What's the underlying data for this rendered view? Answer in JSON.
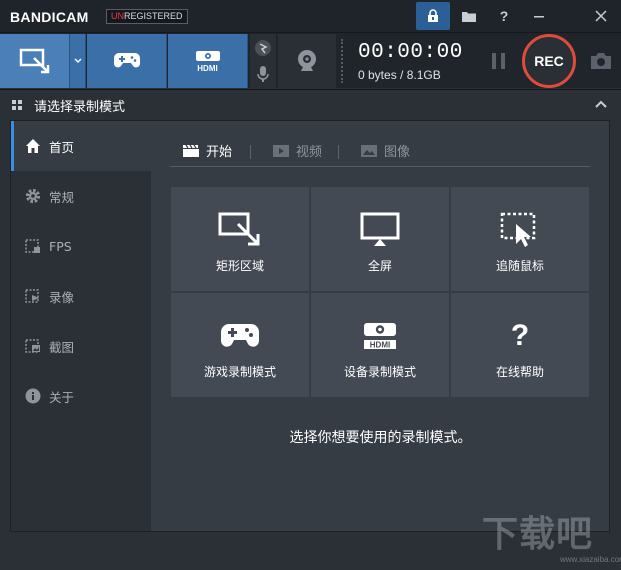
{
  "app": {
    "logo_bandi": "BANDI",
    "logo_cam": "CAM",
    "unreg_prefix": "UN",
    "unreg_rest": "REGISTERED"
  },
  "toolbar": {
    "timer": "00:00:00",
    "size": "0 bytes / 8.1GB",
    "rec_label": "REC",
    "hdmi_label": "HDMI"
  },
  "section": {
    "title": "请选择录制模式"
  },
  "sidebar": {
    "items": [
      {
        "label": "首页",
        "icon": "home-icon",
        "active": true
      },
      {
        "label": "常规",
        "icon": "gear-icon"
      },
      {
        "label": "FPS",
        "icon": "fps-icon"
      },
      {
        "label": "录像",
        "icon": "video-icon"
      },
      {
        "label": "截图",
        "icon": "image-icon"
      },
      {
        "label": "关于",
        "icon": "info-icon"
      }
    ]
  },
  "tabs": [
    {
      "label": "开始",
      "icon": "clapper-icon",
      "active": true
    },
    {
      "label": "视频",
      "icon": "play-icon"
    },
    {
      "label": "图像",
      "icon": "picture-icon"
    }
  ],
  "tiles": [
    {
      "label": "矩形区域",
      "icon": "rectangle-area-icon"
    },
    {
      "label": "全屏",
      "icon": "monitor-icon"
    },
    {
      "label": "追随鼠标",
      "icon": "cursor-follow-icon"
    },
    {
      "label": "游戏录制模式",
      "icon": "gamepad-icon"
    },
    {
      "label": "设备录制模式",
      "icon": "hdmi-icon"
    },
    {
      "label": "在线帮助",
      "icon": "question-icon"
    }
  ],
  "hint": "选择你想要使用的录制模式。",
  "watermark": {
    "text": "下载吧",
    "url": "www.xiazaiba.com"
  },
  "colors": {
    "accent": "#3a6fa8",
    "rec_ring": "#e04c3c",
    "background": "#2b3037",
    "tile": "#434a53"
  }
}
